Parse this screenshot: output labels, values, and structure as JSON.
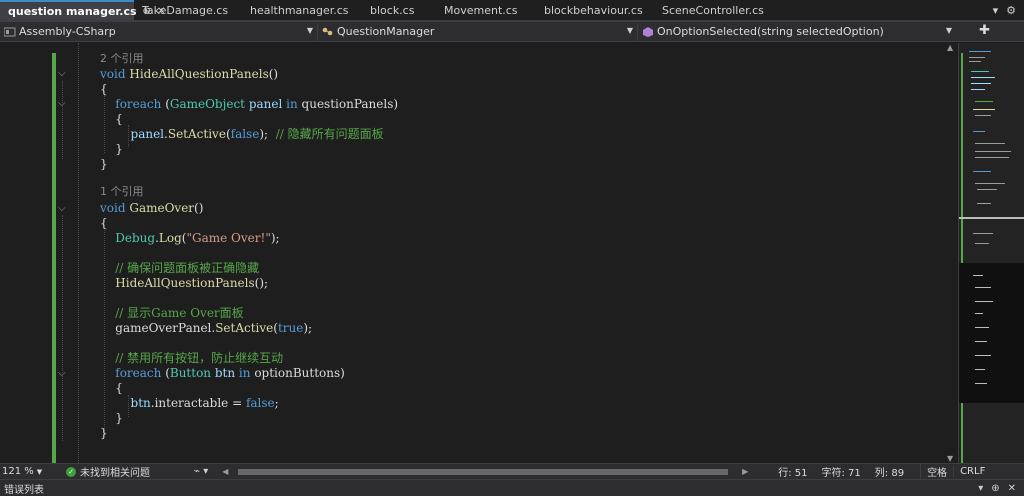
{
  "tabs": [
    {
      "label": "question manager.cs",
      "active": true
    },
    {
      "label": "TakeDamage.cs"
    },
    {
      "label": "healthmanager.cs"
    },
    {
      "label": "block.cs"
    },
    {
      "label": "Movement.cs"
    },
    {
      "label": "blockbehaviour.cs"
    },
    {
      "label": "SceneController.cs"
    }
  ],
  "tab_icons": {
    "pin": "pin-icon",
    "close": "close-icon"
  },
  "navbar": {
    "project": "Assembly-CSharp",
    "class": "QuestionManager",
    "member": "OnOptionSelected(string selectedOption)"
  },
  "code": {
    "ref_hide": "2 个引用",
    "ref_gameover": "1 个引用",
    "comment_hide": "// 隐藏所有问题面板",
    "log_text": "\"Game Over!\"",
    "comment_ensure": "// 确保问题面板被正确隐藏",
    "comment_show": "// 显示Game Over面板",
    "comment_disable": "// 禁用所有按钮，防止继续互动"
  },
  "status": {
    "zoom": "121 %",
    "issues": "未找到相关问题",
    "line": "行: 51",
    "char": "字符: 71",
    "col": "列: 89",
    "indent": "空格",
    "eol": "CRLF"
  },
  "panel": {
    "title": "错误列表"
  },
  "colors": {
    "keyword": "#569cd6",
    "type": "#4ec9b0",
    "method": "#dcdcaa",
    "comment": "#57a64a",
    "string": "#d69d85",
    "accent": "#3c8cc8"
  }
}
